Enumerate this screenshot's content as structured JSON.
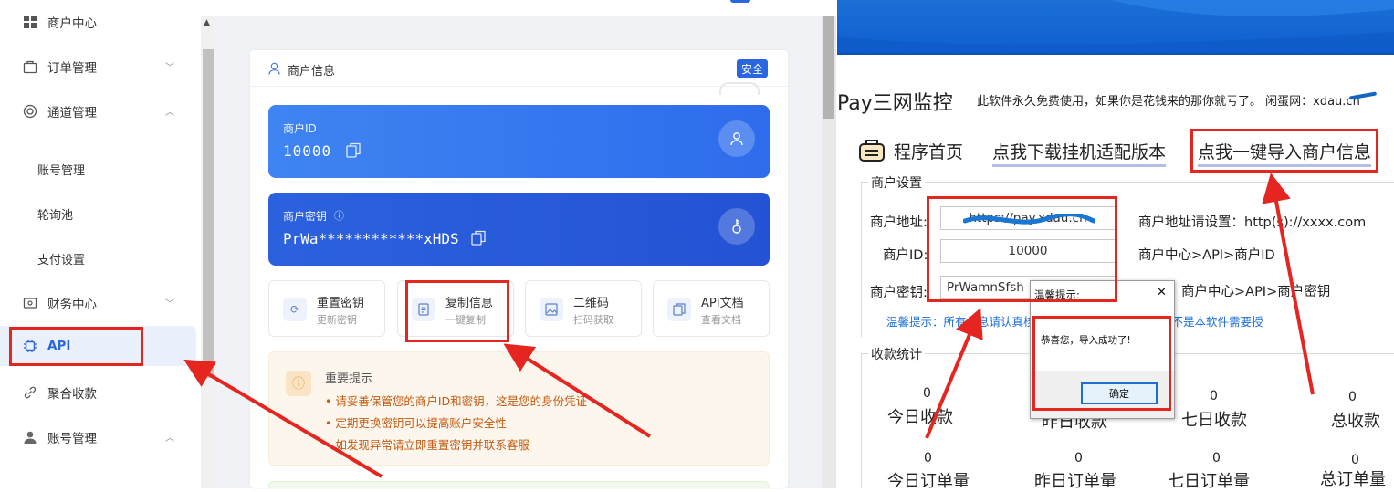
{
  "sidebar": {
    "items": [
      {
        "label": "商户中心",
        "icon": "grid-icon"
      },
      {
        "label": "订单管理",
        "icon": "bag-icon"
      },
      {
        "label": "通道管理",
        "icon": "channel-icon"
      },
      {
        "label": "财务中心",
        "icon": "finance-icon"
      },
      {
        "label": "API",
        "icon": "chip-icon"
      },
      {
        "label": "聚合收款",
        "icon": "link-icon"
      },
      {
        "label": "账号管理",
        "icon": "user-icon"
      }
    ],
    "sub_items": [
      "账号管理",
      "轮询池",
      "支付设置"
    ]
  },
  "merchant_card": {
    "title": "商户信息",
    "badge": "安全",
    "id_label": "商户ID",
    "id_value": "10000",
    "key_label": "商户密钥",
    "key_value": "PrWa************xHDS"
  },
  "tools": [
    {
      "title": "重置密钥",
      "sub": "更新密钥"
    },
    {
      "title": "复制信息",
      "sub": "一键复制"
    },
    {
      "title": "二维码",
      "sub": "扫码获取"
    },
    {
      "title": "API文档",
      "sub": "查看文档"
    }
  ],
  "notice": {
    "title": "重要提示",
    "items": [
      "• 请妥善保管您的商户ID和密钥，这是您的身份凭证",
      "• 定期更换密钥可以提高账户安全性",
      "• 如发现异常请立即重置密钥并联系客服"
    ]
  },
  "monitor": {
    "app_title": "Pay三网监控",
    "subtitle": "此软件永久免费使用，如果你是花钱来的那你就亏了。 闲蛋网：xdau.cn",
    "nav_home": "程序首页",
    "nav_download": "点我下载挂机适配版本",
    "nav_import": "点我一键导入商户信息",
    "settings_group": "商户设置",
    "addr_label": "商户地址:",
    "addr_value": "https://pay.xdau.cn",
    "addr_hint": "商户地址请设置：http(s)://xxxx.com",
    "id_label": "商户ID:",
    "id_value": "10000",
    "id_hint": "商户中心>API>商户ID",
    "key_label": "商户密钥:",
    "key_value": "PrWamnSfsh",
    "key_hint": "商户中心>API>商户密钥",
    "warm_tip": "温馨提示：所有信息请认真核对，支付网站是否正版！并不是本软件需要授",
    "stats_group": "收款统计",
    "stats": [
      {
        "label": "今日收款",
        "value": "0"
      },
      {
        "label": "昨日收款",
        "value": "0"
      },
      {
        "label": "七日收款",
        "value": "0"
      },
      {
        "label": "总收款",
        "value": "0"
      },
      {
        "label": "今日订单量",
        "value": "0"
      },
      {
        "label": "昨日订单量",
        "value": "0"
      },
      {
        "label": "七日订单量",
        "value": "0"
      },
      {
        "label": "总订单量",
        "value": "0"
      }
    ]
  },
  "dialog": {
    "title": "温馨提示:",
    "message": "恭喜您，导入成功了!",
    "ok_label": "确定",
    "close": "✕"
  },
  "colors": {
    "accent": "#2b66e1",
    "annotation": "#e52520",
    "warn_text": "#c45a12"
  }
}
